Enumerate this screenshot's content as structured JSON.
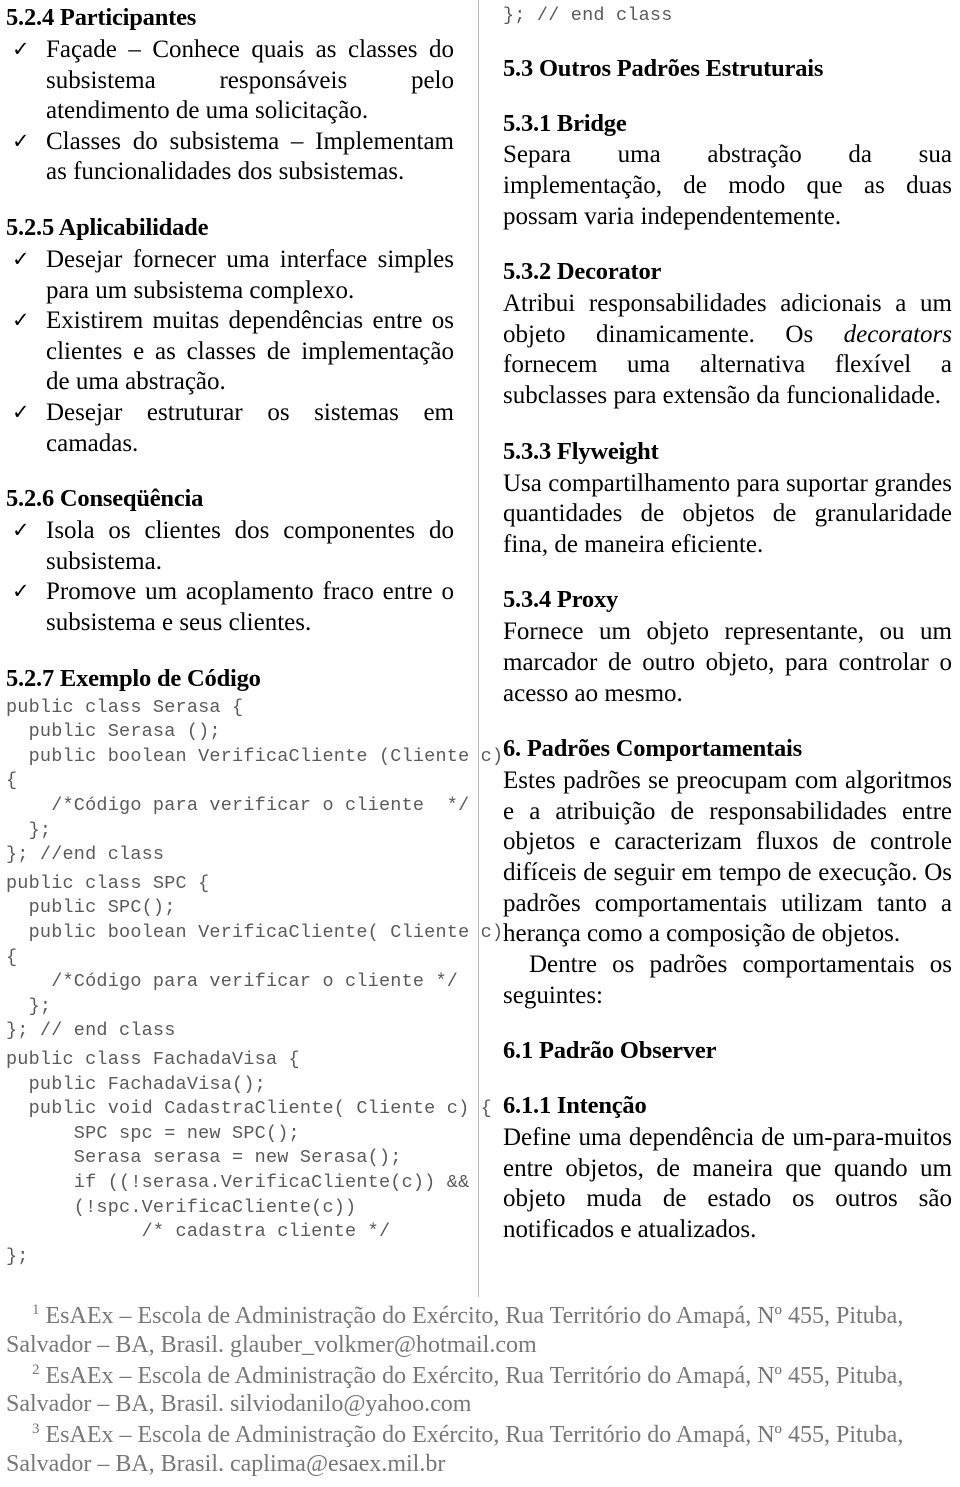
{
  "document": {
    "left_column": {
      "heading_participantes": "5.2.4 Participantes",
      "participantes_items": [
        "Façade – Conhece quais as classes do subsistema responsáveis pelo atendimento de uma solicitação.",
        "Classes do subsistema – Implementam as funcionalidades dos subsistemas."
      ],
      "heading_aplicabilidade": "5.2.5 Aplicabilidade",
      "aplicabilidade_items": [
        "Desejar fornecer uma interface simples para um subsistema complexo.",
        "Existirem muitas dependências entre os clientes e as classes de implementação de uma abstração.",
        "Desejar estruturar os sistemas em camadas."
      ],
      "heading_consequencia": "5.2.6 Conseqüência",
      "consequencia_items": [
        "Isola os clientes dos componentes do subsistema.",
        "Promove um acoplamento fraco entre o subsistema e seus clientes."
      ],
      "heading_exemplo": "5.2.7 Exemplo de Código",
      "code_block_1": "public class Serasa {\n  public Serasa ();\n  public boolean VerificaCliente (Cliente c)\n{\n    /*Código para verificar o cliente  */\n  };\n}; //end class",
      "code_block_2": "public class SPC {\n  public SPC();\n  public boolean VerificaCliente( Cliente c)\n{\n    /*Código para verificar o cliente */\n  };\n}; // end class",
      "code_block_3": "public class FachadaVisa {\n  public FachadaVisa();\n  public void CadastraCliente( Cliente c) {\n      SPC spc = new SPC();\n      Serasa serasa = new Serasa();\n      if ((!serasa.VerificaCliente(c)) &&\n      (!spc.VerificaCliente(c))\n            /* cadastra cliente */\n};"
    },
    "right_column": {
      "code_continuation": "}; // end class",
      "heading_outros": "5.3 Outros Padrões Estruturais",
      "heading_bridge": "5.3.1 Bridge",
      "bridge_text": "Separa uma abstração da sua implementação, de modo que as duas possam varia independentemente.",
      "heading_decorator": "5.3.2 Decorator",
      "decorator_text_part1": "Atribui responsabilidades adicionais a um objeto dinamicamente. Os ",
      "decorator_text_italic": "decorators",
      "decorator_text_part2": " fornecem uma alternativa flexível a subclasses para extensão da funcionalidade.",
      "heading_flyweight": "5.3.3 Flyweight",
      "flyweight_text": "Usa compartilhamento para suportar grandes quantidades de objetos de granularidade fina, de maneira eficiente.",
      "heading_proxy": "5.3.4 Proxy",
      "proxy_text": "Fornece um objeto representante, ou um marcador de outro objeto, para controlar o acesso ao mesmo.",
      "heading_comportamentais": "6. Padrões Comportamentais",
      "comportamentais_text": "Estes padrões se preocupam com algoritmos e a atribuição de responsabilidades entre objetos e caracterizam fluxos de controle difíceis de seguir em tempo de execução. Os padrões comportamentais utilizam tanto a herança como a composição de objetos.",
      "comportamentais_text2": "Dentre os padrões comportamentais os seguintes:",
      "heading_observer": "6.1 Padrão Observer",
      "heading_intencao": "6.1.1 Intenção",
      "intencao_text": "Define uma dependência de um-para-muitos entre objetos, de maneira que quando um objeto muda de estado os outros são notificados e atualizados."
    },
    "footnotes": [
      {
        "marker": "1",
        "text": "EsAEx – Escola de Administração do Exército, Rua Território do Amapá, Nº 455, Pituba, Salvador – BA, Brasil. glauber_volkmer@hotmail.com"
      },
      {
        "marker": "2",
        "text": "EsAEx – Escola de Administração do Exército, Rua Território do Amapá, Nº 455, Pituba, Salvador – BA, Brasil. silviodanilo@yahoo.com"
      },
      {
        "marker": "3",
        "text": "EsAEx – Escola de Administração do Exército, Rua Território do Amapá, Nº 455, Pituba, Salvador – BA, Brasil. caplima@esaex.mil.br"
      }
    ],
    "icons": {
      "check": "✓"
    },
    "colors": {
      "text": "#000000",
      "code": "#5a5a5a",
      "footnote": "#777777",
      "divider": "#b9b9b9"
    }
  }
}
